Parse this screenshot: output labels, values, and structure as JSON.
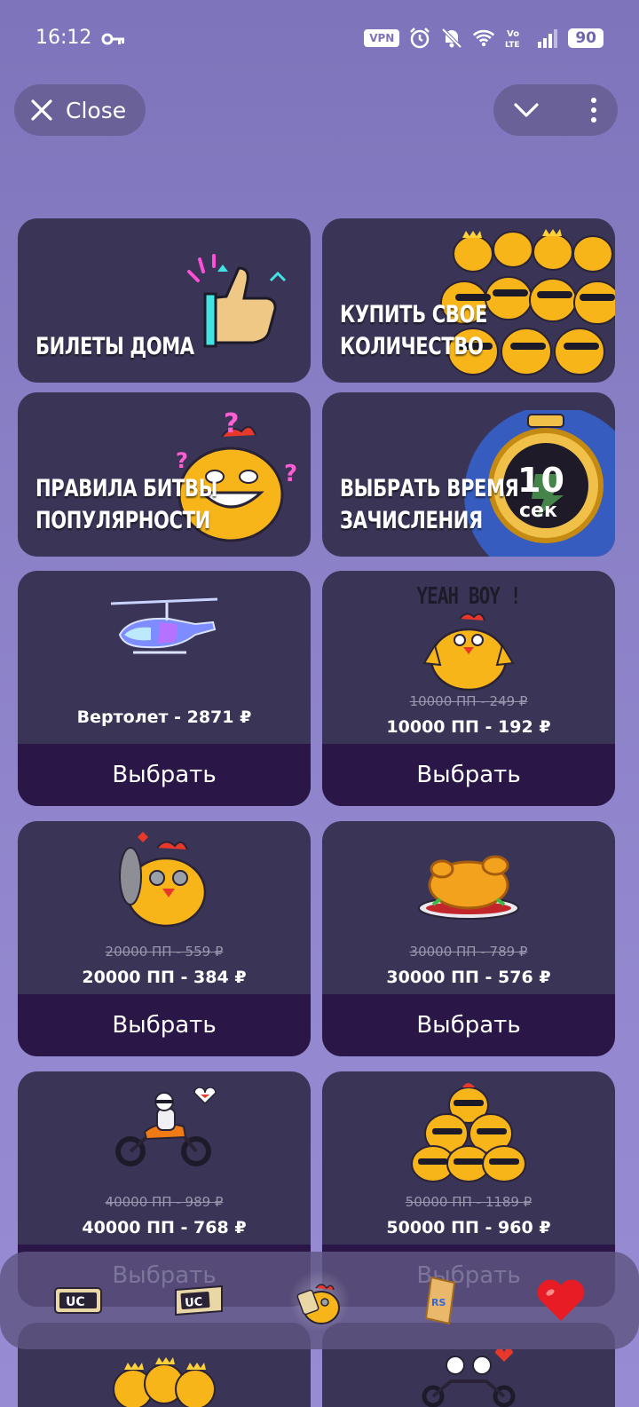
{
  "status_bar": {
    "time": "16:12",
    "vpn": "VPN",
    "battery": "90"
  },
  "top": {
    "close_label": "Close"
  },
  "promos": [
    {
      "title": "БИЛЕТЫ ДОМА",
      "icon": "thumbs-up-icon"
    },
    {
      "title": "КУПИТЬ СВОЕ\nКОЛИЧЕСТВО",
      "icon": "chicken-crowd-icon"
    },
    {
      "title": "ПРАВИЛА БИТВЫ\nПОПУЛЯРНОСТИ",
      "icon": "chicken-question-icon"
    },
    {
      "title": "ВЫБРАТЬ ВРЕМЯ\nЗАЧИСЛЕНИЯ",
      "icon": "stopwatch-icon",
      "badge_num": "10",
      "badge_unit": "сек"
    }
  ],
  "products": [
    {
      "name": "Вертолет - 2871 ₽",
      "old": "",
      "icon": "helicopter-icon"
    },
    {
      "name": "10000 ПП - 192 ₽",
      "old": "10000 ПП - 249 ₽",
      "icon": "chicken-thumbs-icon",
      "caption": "YEAH BOY !"
    },
    {
      "name": "20000 ПП - 384 ₽",
      "old": "20000 ПП - 559 ₽",
      "icon": "chicken-pan-icon"
    },
    {
      "name": "30000 ПП - 576 ₽",
      "old": "30000 ПП - 789 ₽",
      "icon": "roast-chicken-icon"
    },
    {
      "name": "40000 ПП - 768 ₽",
      "old": "40000 ПП - 989 ₽",
      "icon": "motorcycle-icon"
    },
    {
      "name": "50000 ПП - 960 ₽",
      "old": "50000 ПП - 1189 ₽",
      "icon": "chicken-squad-icon"
    }
  ],
  "choose_label": "Выбрать",
  "bottom_nav": [
    {
      "icon": "uc-ticket-icon",
      "label": "UC"
    },
    {
      "icon": "uc-ticket-alt-icon",
      "label": "UC"
    },
    {
      "icon": "chicken-nav-icon"
    },
    {
      "icon": "pass-ticket-icon",
      "label": "RS"
    },
    {
      "icon": "heart-icon"
    }
  ],
  "colors": {
    "card_bg": "#3a3556",
    "button_bg": "#2a1747",
    "accent_yellow": "#f7b519"
  }
}
